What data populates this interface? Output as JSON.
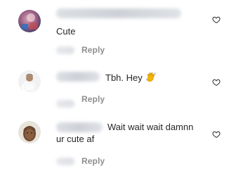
{
  "comments": [
    {
      "text": "Cute",
      "reply_label": "Reply",
      "avatar_color": "#8c5a7a"
    },
    {
      "text": "Tbh. Hey",
      "emoji": "waving-hand-emoji",
      "reply_label": "Reply",
      "avatar_color": "#e8d2c2"
    },
    {
      "text_line1": "Wait wait wait damnn",
      "text_line2": "ur cute af",
      "reply_label": "Reply",
      "avatar_color": "#6b4a34"
    }
  ],
  "icons": {
    "like": "heart-outline-icon"
  },
  "colors": {
    "text": "#262626",
    "secondary": "#8e8e8e",
    "heart_stroke": "#262626"
  }
}
